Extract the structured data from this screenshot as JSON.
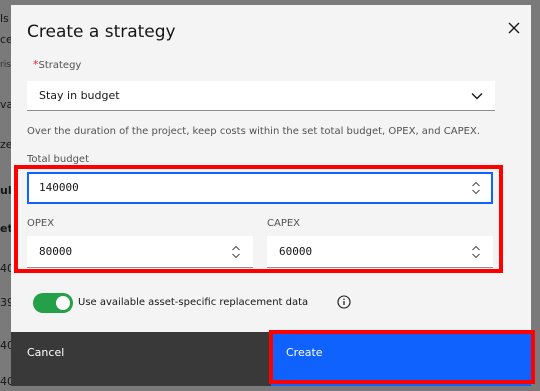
{
  "background": {
    "rows": [
      {
        "text": "ls"
      },
      {
        "text": "ce"
      },
      {
        "text": "ris"
      },
      {
        "text": "vai"
      },
      {
        "text": "zed"
      },
      {
        "text": "ults"
      },
      {
        "text": "et"
      },
      {
        "text": "40"
      },
      {
        "text": "39"
      },
      {
        "text": "40"
      },
      {
        "text": "40"
      }
    ]
  },
  "modal": {
    "title": "Create a strategy",
    "strategy": {
      "required_mark": "*",
      "label": "Strategy",
      "value": "Stay in budget"
    },
    "helper_text": "Over the duration of the project, keep costs within the set total budget, OPEX, and CAPEX.",
    "total_budget": {
      "label": "Total budget",
      "value": "140000"
    },
    "opex": {
      "label": "OPEX",
      "value": "80000"
    },
    "capex": {
      "label": "CAPEX",
      "value": "60000"
    },
    "toggle": {
      "label": "Use available asset-specific replacement data",
      "on": true
    },
    "cancel_label": "Cancel",
    "create_label": "Create"
  },
  "colors": {
    "primary": "#0f62fe",
    "toggle_on": "#24a148",
    "highlight": "#ff0000",
    "required": "#da1e28"
  }
}
